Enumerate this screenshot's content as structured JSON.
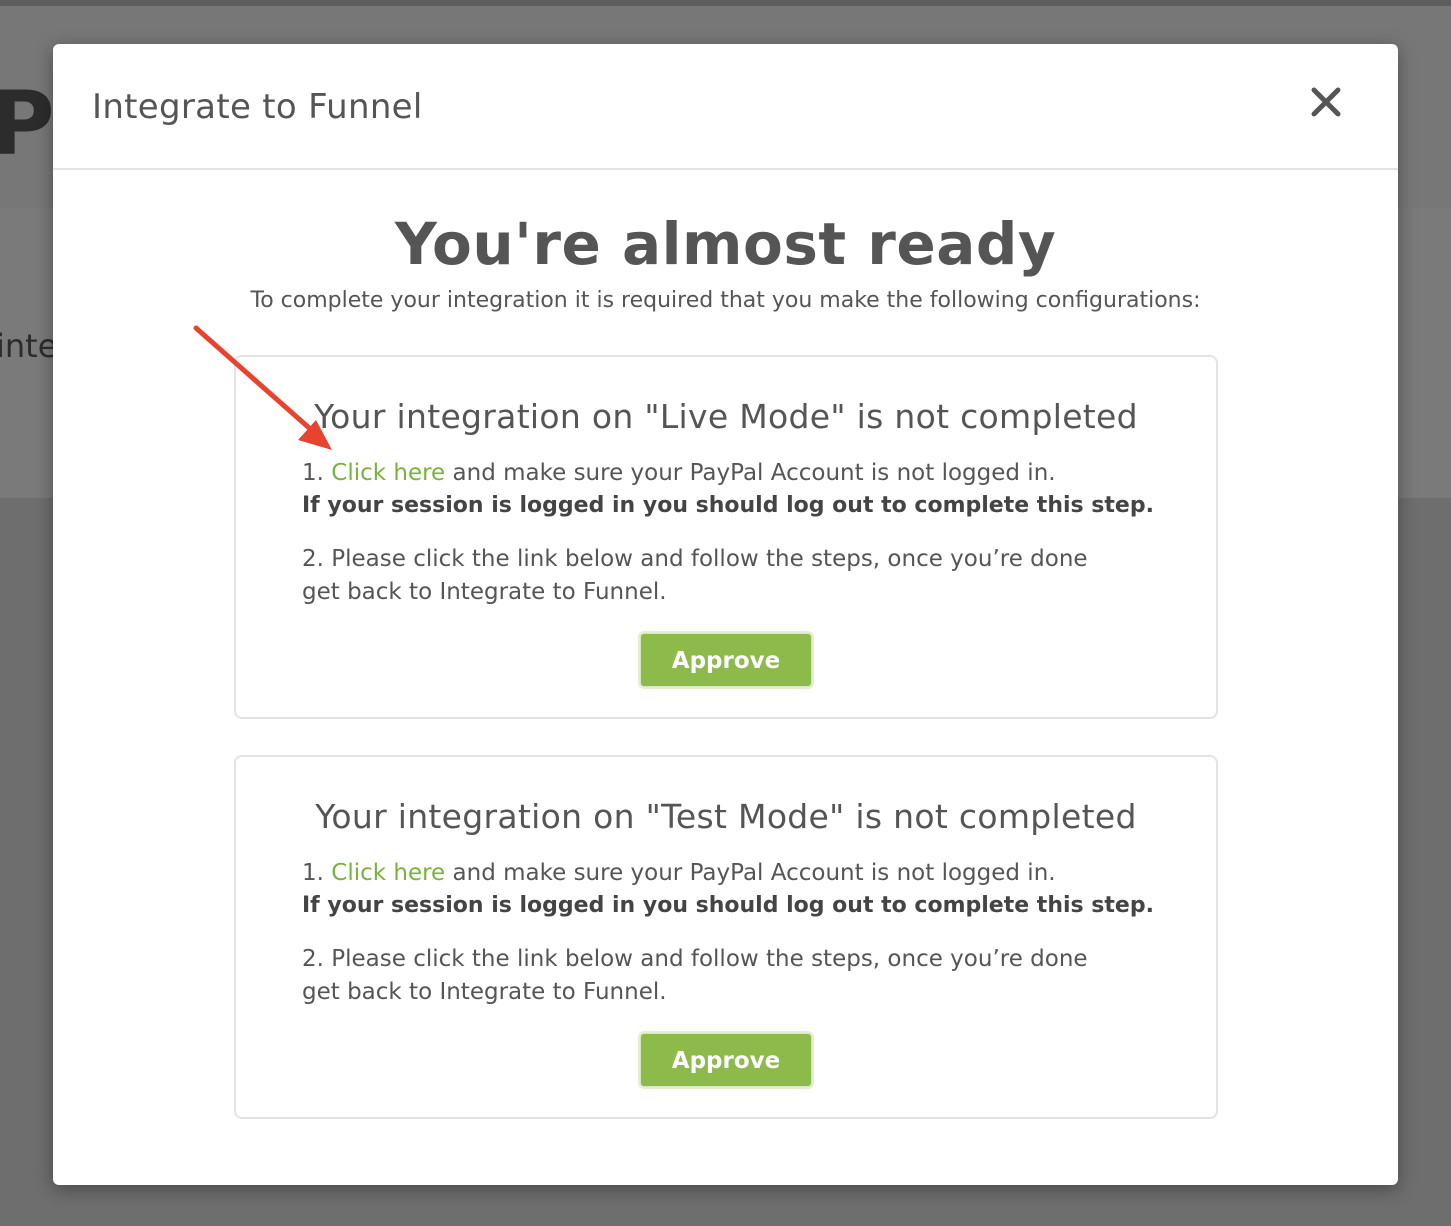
{
  "background": {
    "title_fragment": "Pa",
    "text_fragment": "inte"
  },
  "modal": {
    "title": "Integrate to Funnel",
    "close_icon": "close-icon",
    "heading": "You're almost ready",
    "subheading": "To complete your integration it is required that you make the following configurations:",
    "cards": [
      {
        "title": "Your integration on \"Live Mode\" is not completed",
        "step1_prefix": "1. ",
        "step1_link": "Click here",
        "step1_suffix": " and make sure your PayPal Account is not logged in.",
        "warning": "If your session is logged in you should log out to complete this step.",
        "step2": "2. Please click the link below and follow the steps, once you’re done get back to Integrate to Funnel.",
        "button": "Approve"
      },
      {
        "title": "Your integration on \"Test Mode\" is not completed",
        "step1_prefix": "1. ",
        "step1_link": "Click here",
        "step1_suffix": " and make sure your PayPal Account is not logged in.",
        "warning": "If your session is logged in you should log out to complete this step.",
        "step2": "2. Please click the link below and follow the steps, once you’re done get back to Integrate to Funnel.",
        "button": "Approve"
      }
    ]
  },
  "colors": {
    "accent_green": "#8cba4b",
    "link_green": "#7ab23f",
    "annotation_arrow": "#e8432f",
    "overlay": "#6e6e6e"
  }
}
